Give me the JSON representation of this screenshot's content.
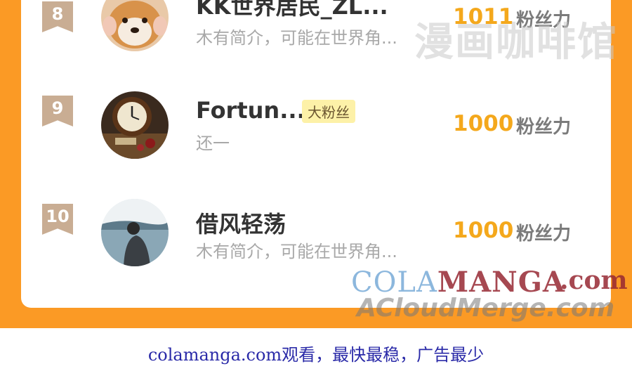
{
  "watermarks": {
    "top": "漫画咖啡馆",
    "cola_part1": "COLA",
    "cola_part2": "MANGA",
    "cola_com": ".com",
    "acloud": "ACloudMerge.com"
  },
  "rows": [
    {
      "rank": "8",
      "name": "KK世界居民_ZL...",
      "bio": "木有简介，可能在世界角...",
      "count": "1011",
      "unit": "粉丝力",
      "badge": ""
    },
    {
      "rank": "9",
      "name": "Fortun...",
      "bio": "还一",
      "count": "1000",
      "unit": "粉丝力",
      "badge": "大粉丝"
    },
    {
      "rank": "10",
      "name": "借风轻荡",
      "bio": "木有简介，可能在世界角...",
      "count": "1000",
      "unit": "粉丝力",
      "badge": ""
    }
  ],
  "footer": "colamanga.com观看，最快最稳，广告最少",
  "colors": {
    "frame": "#fb9a25",
    "count": "#f4a81c",
    "rank_badge": "#c9ad93",
    "footer": "#2a2aa8"
  }
}
